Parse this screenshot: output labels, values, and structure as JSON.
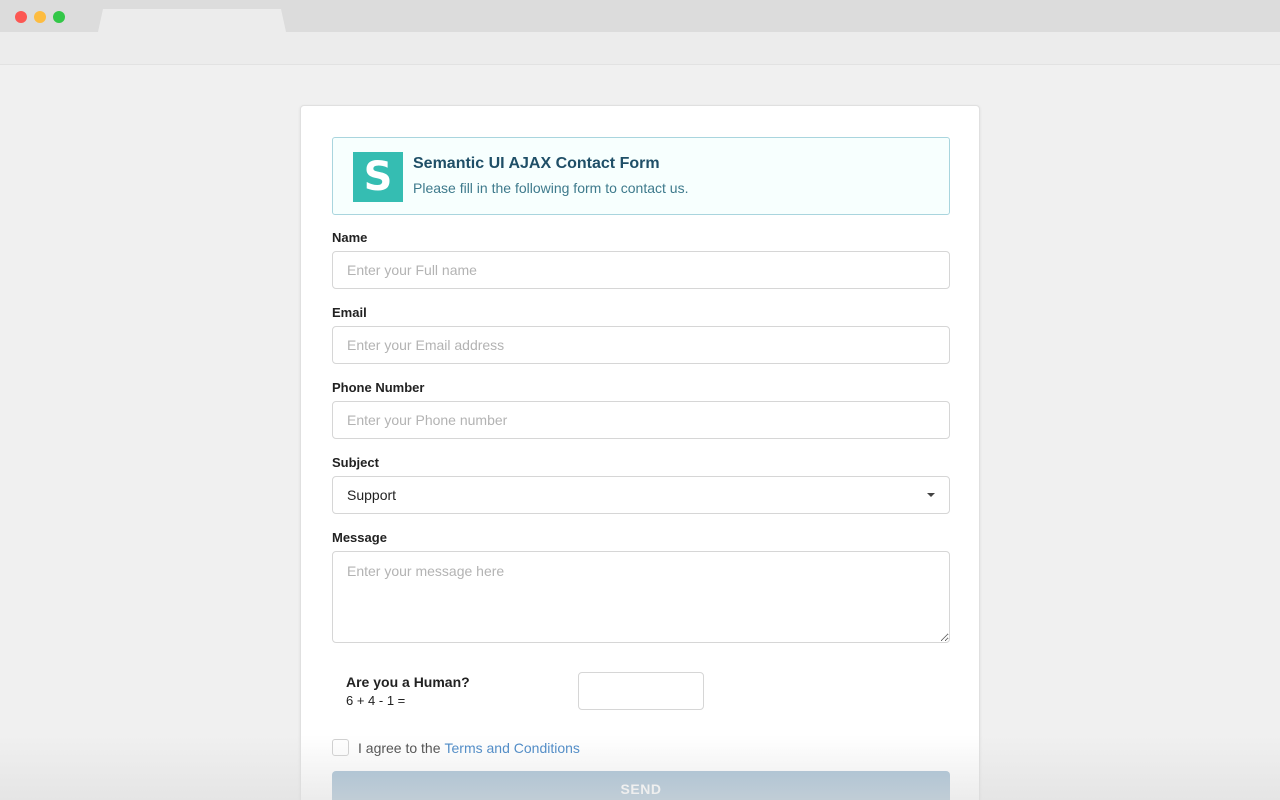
{
  "header": {
    "logo_letter": "S",
    "title": "Semantic UI AJAX Contact Form",
    "subtitle": "Please fill in the following form to contact us."
  },
  "form": {
    "name": {
      "label": "Name",
      "placeholder": "Enter your Full name",
      "value": ""
    },
    "email": {
      "label": "Email",
      "placeholder": "Enter your Email address",
      "value": ""
    },
    "phone": {
      "label": "Phone Number",
      "placeholder": "Enter your Phone number",
      "value": ""
    },
    "subject": {
      "label": "Subject",
      "selected": "Support"
    },
    "message": {
      "label": "Message",
      "placeholder": "Enter your message here",
      "value": ""
    },
    "human": {
      "question": "Are you a Human?",
      "equation": "6 + 4 - 1 =",
      "answer": ""
    },
    "agree": {
      "text": "I agree to the",
      "link": "Terms and Conditions",
      "checked": false
    },
    "send_label": "SEND"
  },
  "colors": {
    "logo": "#35bdb2",
    "header_bg": "#f7fffe",
    "header_border": "#a9d5de",
    "link": "#4183c4",
    "send_disabled": "#9fbbd0"
  },
  "icons": {
    "window_controls": [
      "close-dot",
      "minimize-dot",
      "zoom-dot"
    ],
    "select": "caret-down-icon"
  }
}
